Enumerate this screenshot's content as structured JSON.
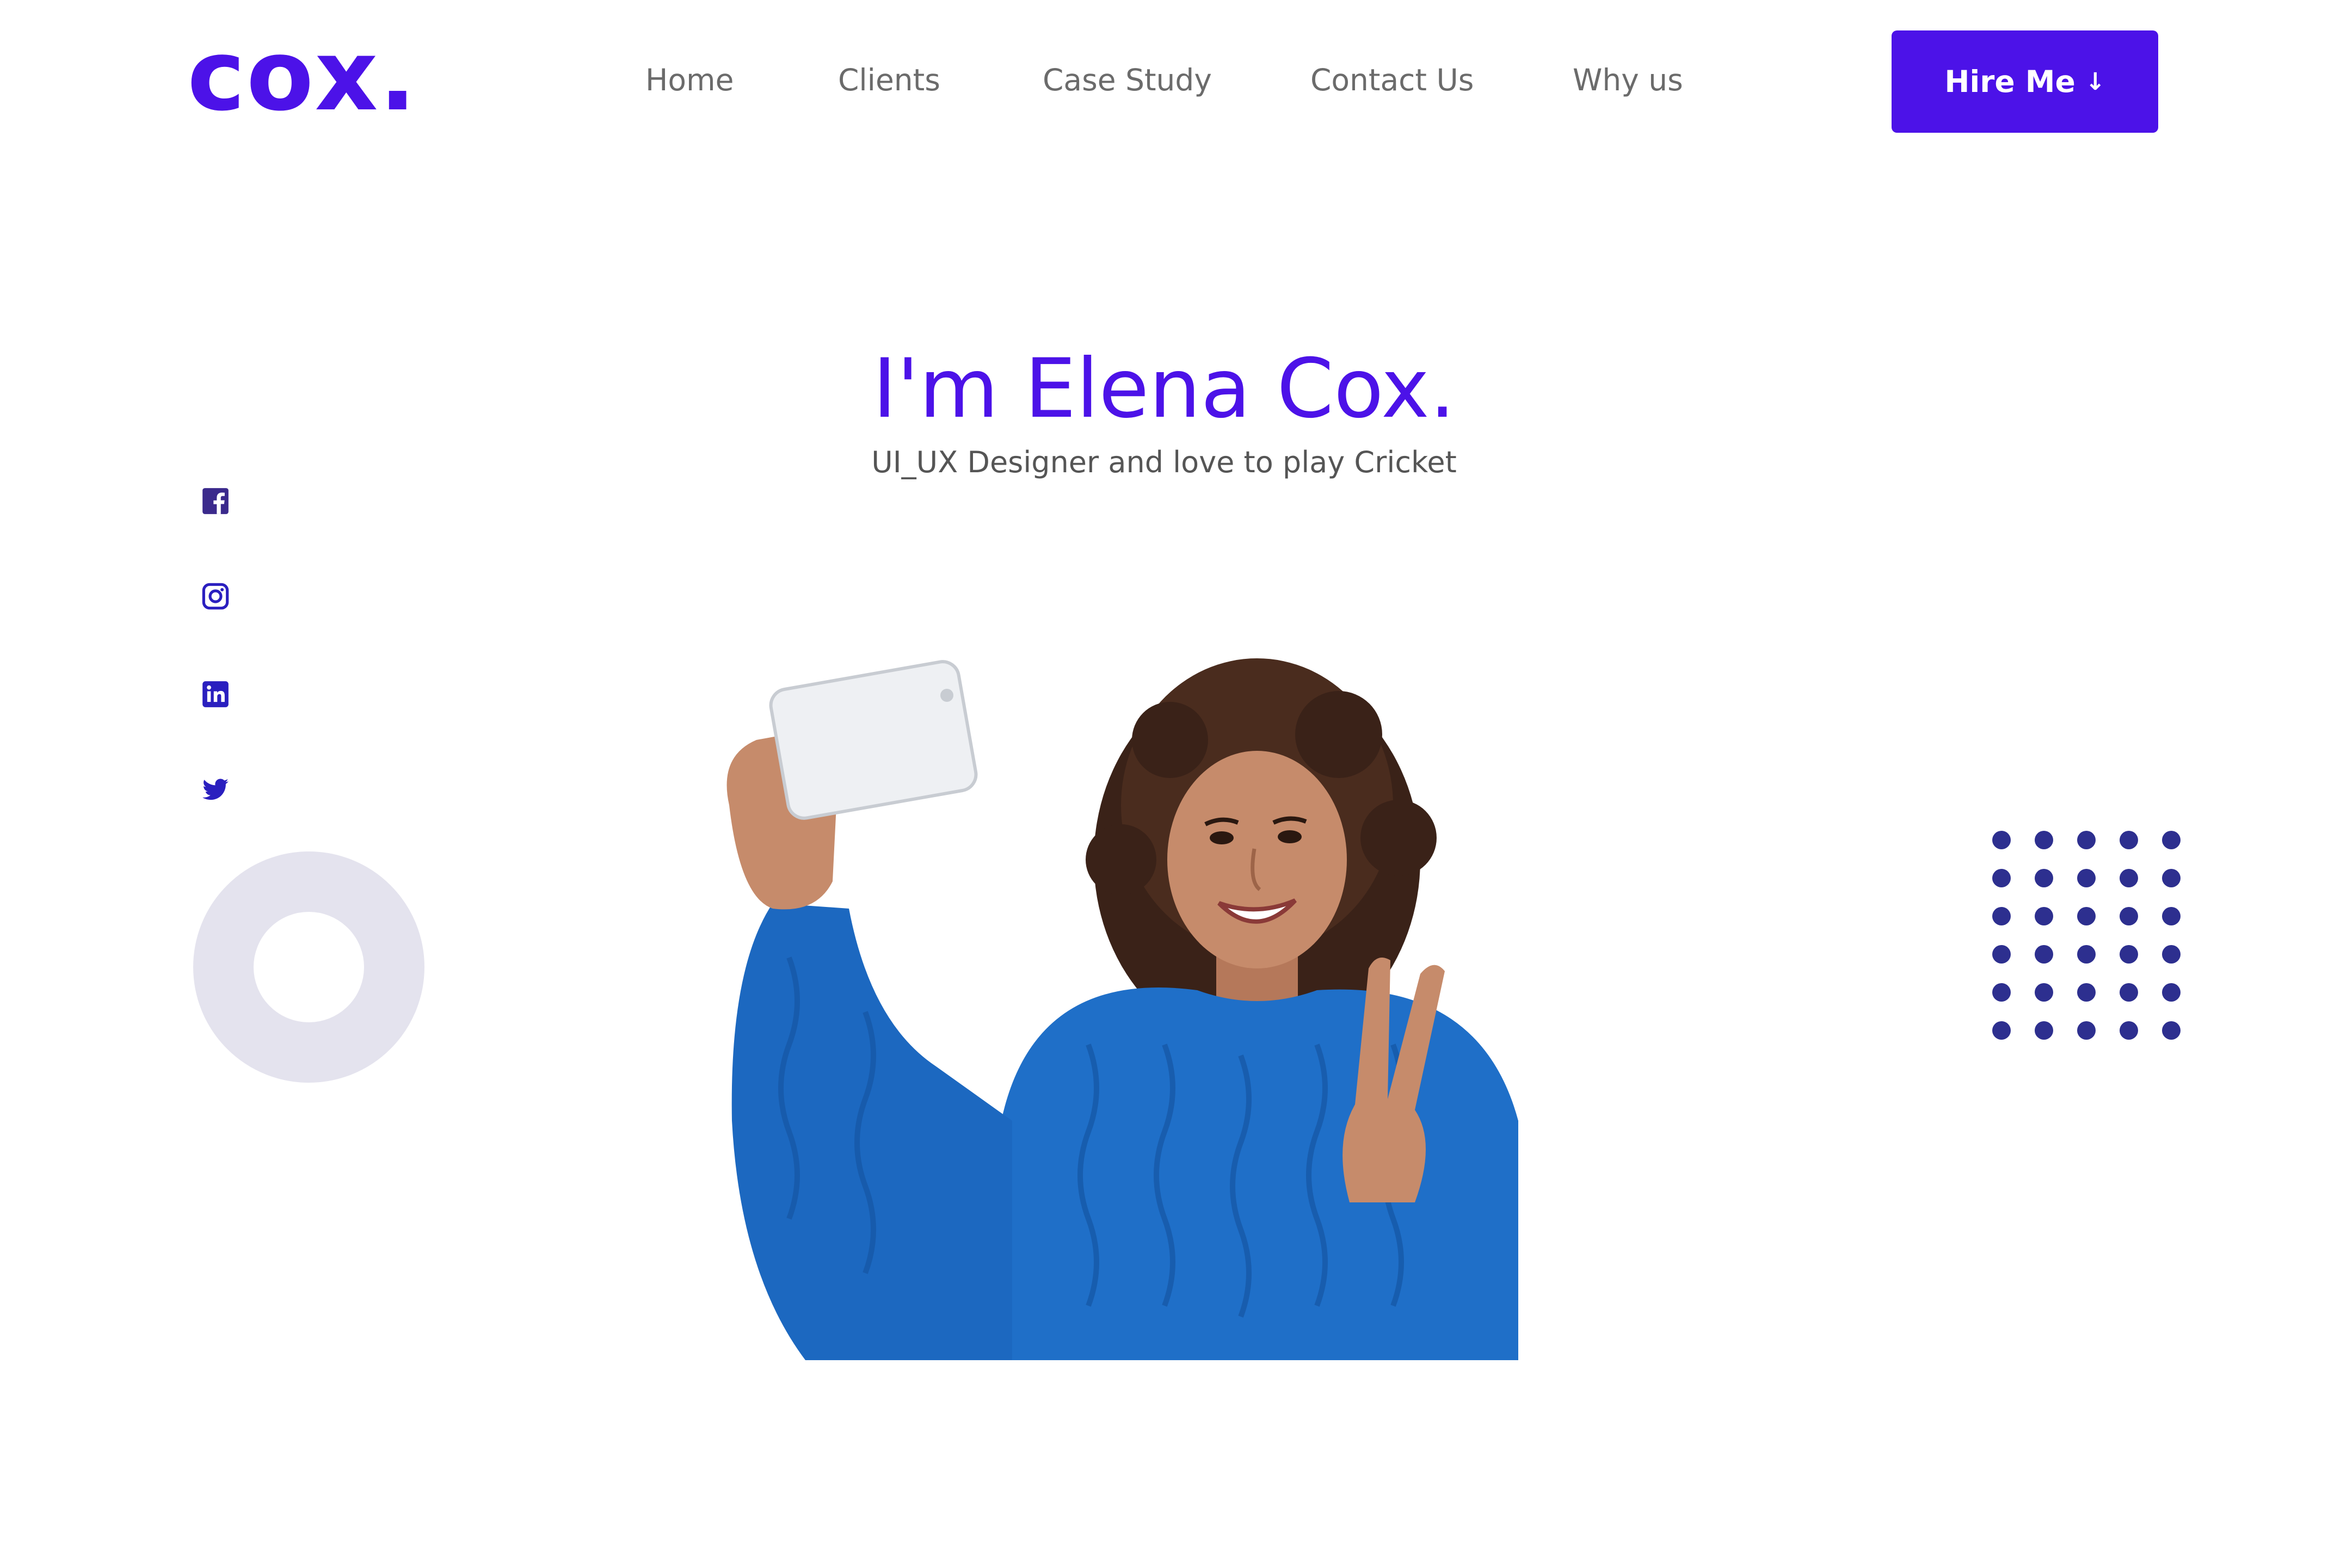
{
  "brand": {
    "logo": "cox.",
    "accent_color": "#4c12e8"
  },
  "nav": {
    "items": [
      {
        "label": "Home"
      },
      {
        "label": "Clients"
      },
      {
        "label": "Case Study"
      },
      {
        "label": "Contact Us"
      },
      {
        "label": "Why us"
      }
    ],
    "cta": {
      "label": "Hire Me",
      "icon": "arrow-down-icon"
    }
  },
  "hero": {
    "title": "I'm Elena Cox.",
    "subtitle": "UI_UX Designer and love to play Cricket"
  },
  "social": [
    {
      "icon": "facebook-icon"
    },
    {
      "icon": "instagram-icon"
    },
    {
      "icon": "linkedin-icon"
    },
    {
      "icon": "twitter-icon"
    }
  ],
  "decor": {
    "ring_color": "#e4e3ee",
    "dots_color": "#2d2f8f",
    "dots_rows": 6,
    "dots_cols": 5
  },
  "image": {
    "subject": "woman in blue sweater taking selfie, peace sign"
  }
}
